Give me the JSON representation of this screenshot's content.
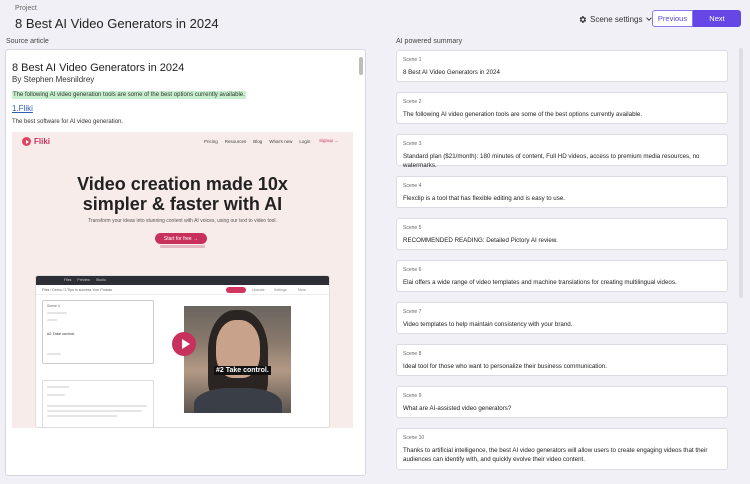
{
  "header": {
    "eyebrow": "Project",
    "title": "8 Best AI Video Generators in 2024",
    "scene_settings_label": "Scene settings",
    "previous_label": "Previous",
    "next_label": "Next"
  },
  "left": {
    "label": "Source article",
    "article": {
      "title": "8 Best AI Video Generators in 2024",
      "author": "By Stephen Mesnildrey",
      "highlight": "The following AI video generation tools are some of the best options currently available.",
      "link": "1.Fliki",
      "desc": "The best software for AI video generation."
    },
    "screenshot": {
      "brand": "Fliki",
      "menu": [
        "Pricing",
        "Resources",
        "Blog",
        "What's new",
        "Login"
      ],
      "signup": "Signup →",
      "hero_line1": "Video creation made 10x",
      "hero_line2": "simpler & faster with AI",
      "hero_sub": "Transform your ideas into stunning content with AI voices, using our text to video tool.",
      "cta": "Start for free →",
      "app_tabs": [
        "Files",
        "Preview",
        "Studio"
      ],
      "app_crumbs": "Files  /  Demo  /  3 Tips to success Your Podcas",
      "scene_label": "Scene 4",
      "scene_text": "#2 Take control.",
      "caption": "#2 Take control.",
      "mini_a": "Upscale",
      "mini_b": "Settings",
      "mini_c": "More"
    }
  },
  "right": {
    "label": "AI powered summary",
    "scenes": [
      {
        "num": "Scene 1",
        "text": "8 Best AI Video Generators in 2024"
      },
      {
        "num": "Scene 2",
        "text": "The following AI video generation tools are some of the best options currently available."
      },
      {
        "num": "Scene 3",
        "text": "Standard plan ($21/month): 180 minutes of content, Full HD videos, access to premium media resources, no watermarks."
      },
      {
        "num": "Scene 4",
        "text": "Flexclip is a tool that has flexible editing and is easy to use."
      },
      {
        "num": "Scene 5",
        "text": "RECOMMENDED READING: Detailed Pictory AI review."
      },
      {
        "num": "Scene 6",
        "text": "Elai offers a wide range of video templates and machine translations for creating multilingual videos."
      },
      {
        "num": "Scene 7",
        "text": "Video templates to help maintain consistency with your brand."
      },
      {
        "num": "Scene 8",
        "text": "Ideal tool for those who want to personalize their business communication."
      },
      {
        "num": "Scene 9",
        "text": "What are AI-assisted video generators?"
      },
      {
        "num": "Scene 10",
        "text": "Thanks to artificial intelligence, the best AI video generators will allow users to create engaging videos that their audiences can identify with, and quickly evolve their video content."
      }
    ]
  },
  "colors": {
    "accent": "#6647e6",
    "highlight": "#c7f0cf",
    "brand_pink": "#c8305d",
    "background": "#f1f0f6"
  },
  "icons": {
    "scene_settings": "gear-icon",
    "dropdown": "chevron-down-icon",
    "play": "play-icon"
  }
}
